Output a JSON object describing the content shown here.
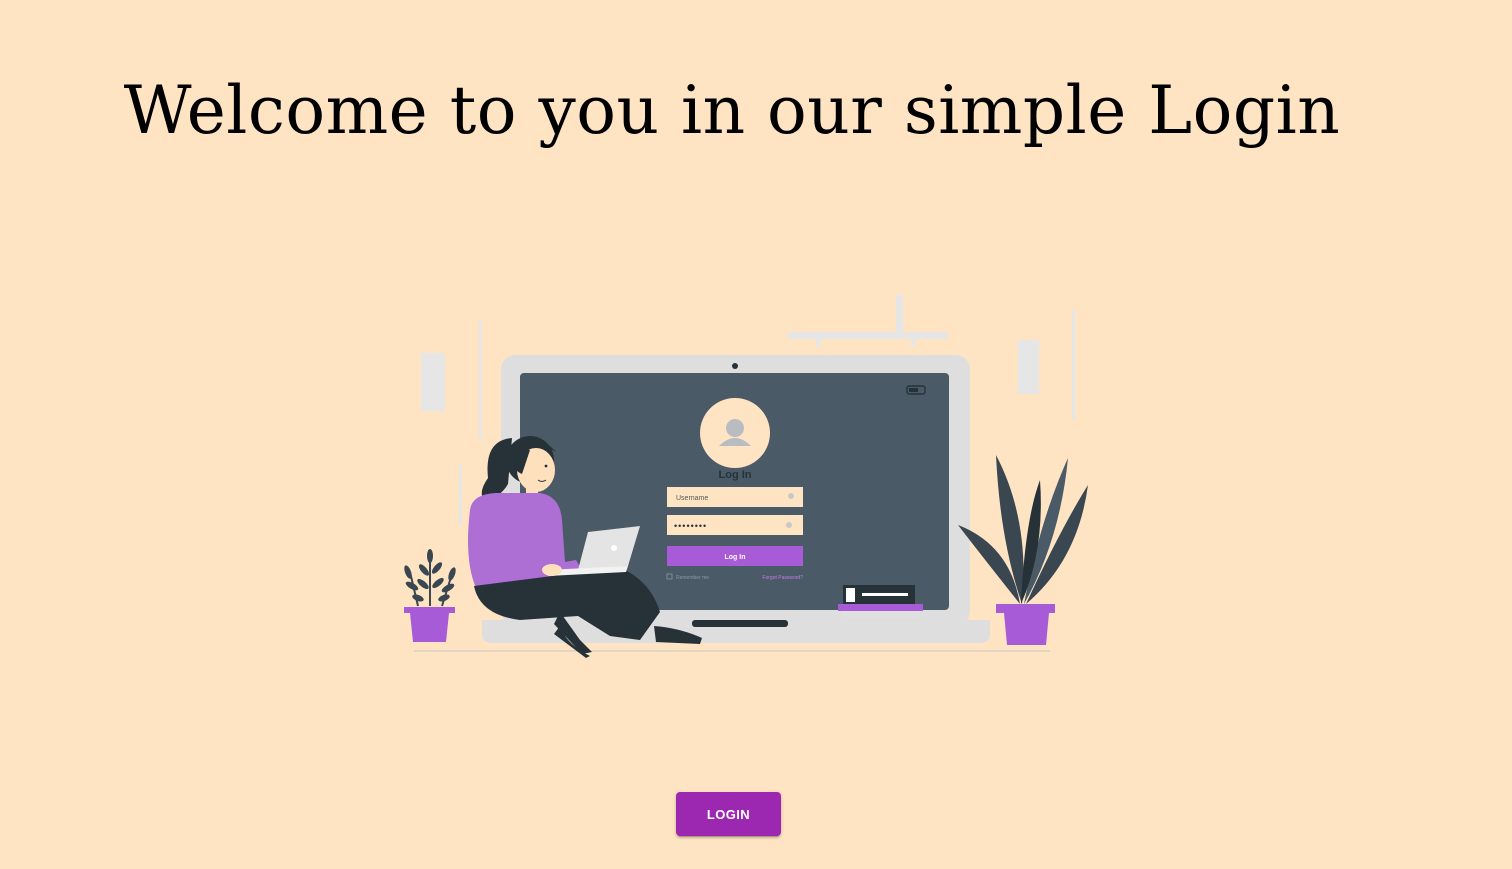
{
  "header": {
    "title": "Welcome to you in our simple Login"
  },
  "illustration": {
    "screen_heading": "Log In",
    "username_placeholder": "Username",
    "password_mask": "••••••••",
    "screen_button_label": "Log In",
    "remember_label": "Remember me",
    "forgot_label": "Forgot Password?"
  },
  "actions": {
    "login_label": "LOGIN"
  },
  "colors": {
    "background": "#ffe4c4",
    "accent": "#9c27b0",
    "screen": "#4a5a66",
    "plant_dark": "#3a4650"
  }
}
